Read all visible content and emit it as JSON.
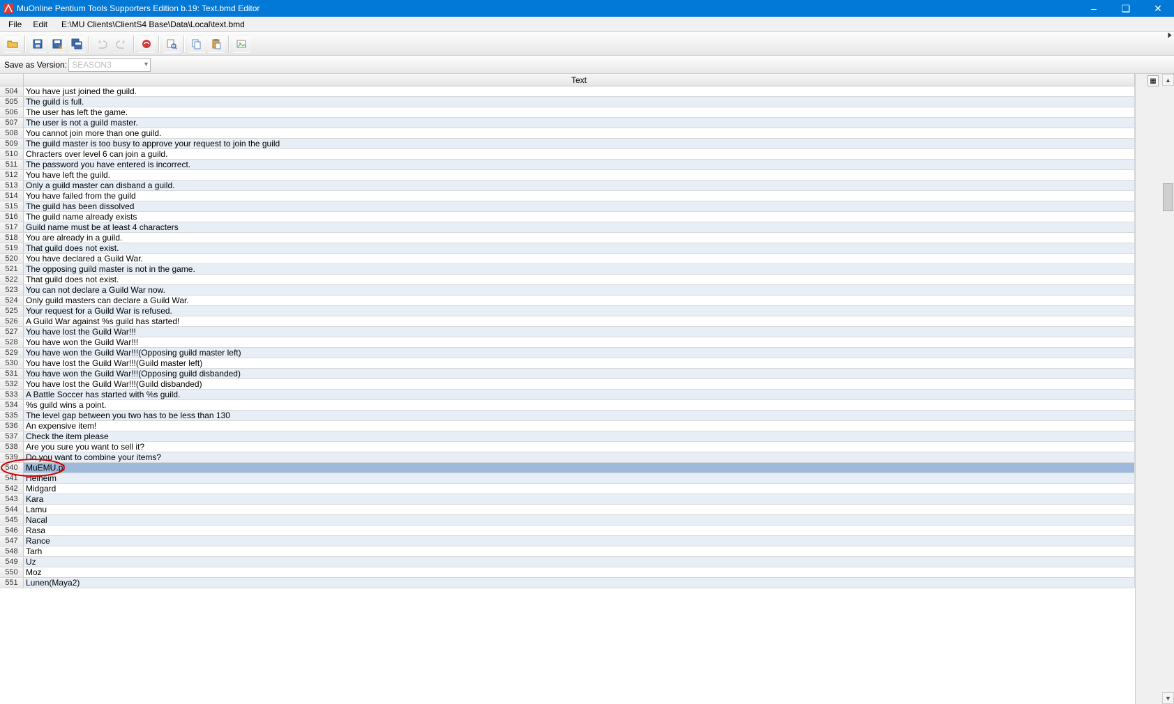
{
  "window": {
    "title": "MuOnline Pentium Tools Supporters Edition b.19: Text.bmd Editor"
  },
  "menu": {
    "file": "File",
    "edit": "Edit",
    "path": "E:\\MU Clients\\ClientS4 Base\\Data\\Local\\text.bmd"
  },
  "version": {
    "label": "Save as Version:",
    "value": "SEASON3"
  },
  "grid": {
    "column": "Text",
    "selected_id": "540",
    "rows": [
      {
        "id": "504",
        "text": "You have just joined the guild."
      },
      {
        "id": "505",
        "text": "The guild is full."
      },
      {
        "id": "506",
        "text": "The user has left the game."
      },
      {
        "id": "507",
        "text": "The user is not a guild master."
      },
      {
        "id": "508",
        "text": "You cannot join more than one guild."
      },
      {
        "id": "509",
        "text": "The guild master is too busy to approve your request to join the guild"
      },
      {
        "id": "510",
        "text": "Chracters over level 6 can join a guild."
      },
      {
        "id": "511",
        "text": "The password you have entered is incorrect."
      },
      {
        "id": "512",
        "text": "You have left the guild."
      },
      {
        "id": "513",
        "text": "Only a guild master can disband a guild."
      },
      {
        "id": "514",
        "text": "You have failed from the guild"
      },
      {
        "id": "515",
        "text": "The guild has been dissolved"
      },
      {
        "id": "516",
        "text": "The guild name already exists"
      },
      {
        "id": "517",
        "text": "Guild name must be at least 4 characters"
      },
      {
        "id": "518",
        "text": "You are already in a guild."
      },
      {
        "id": "519",
        "text": "That guild does not exist."
      },
      {
        "id": "520",
        "text": "You have declared a Guild War."
      },
      {
        "id": "521",
        "text": "The opposing guild master is not in the game."
      },
      {
        "id": "522",
        "text": "That guild does not exist."
      },
      {
        "id": "523",
        "text": "You can not declare a Guild War now."
      },
      {
        "id": "524",
        "text": "Only guild masters can declare a Guild War."
      },
      {
        "id": "525",
        "text": "Your request for a Guild War is refused."
      },
      {
        "id": "526",
        "text": "A Guild War against %s guild has started!"
      },
      {
        "id": "527",
        "text": "You have lost the Guild War!!!"
      },
      {
        "id": "528",
        "text": "You have won the Guild War!!!"
      },
      {
        "id": "529",
        "text": "You have won the Guild War!!!(Opposing guild master left)"
      },
      {
        "id": "530",
        "text": "You have lost the Guild War!!!(Guild master left)"
      },
      {
        "id": "531",
        "text": "You have won the Guild War!!!(Opposing guild disbanded)"
      },
      {
        "id": "532",
        "text": "You have lost the Guild War!!!(Guild disbanded)"
      },
      {
        "id": "533",
        "text": "A Battle Soccer has started with %s guild."
      },
      {
        "id": "534",
        "text": "%s guild wins a point."
      },
      {
        "id": "535",
        "text": "The level gap between you two has to be less than 130"
      },
      {
        "id": "536",
        "text": "An expensive item!"
      },
      {
        "id": "537",
        "text": "Check the item please"
      },
      {
        "id": "538",
        "text": "Are you sure you want to sell it?"
      },
      {
        "id": "539",
        "text": "Do you want to combine your items?"
      },
      {
        "id": "540",
        "text": "MuEMU.pl"
      },
      {
        "id": "541",
        "text": "Helheim"
      },
      {
        "id": "542",
        "text": "Midgard"
      },
      {
        "id": "543",
        "text": "Kara"
      },
      {
        "id": "544",
        "text": "Lamu"
      },
      {
        "id": "545",
        "text": "Nacal"
      },
      {
        "id": "546",
        "text": "Rasa"
      },
      {
        "id": "547",
        "text": "Rance"
      },
      {
        "id": "548",
        "text": "Tarh"
      },
      {
        "id": "549",
        "text": "Uz"
      },
      {
        "id": "550",
        "text": "Moz"
      },
      {
        "id": "551",
        "text": "Lunen(Maya2)"
      }
    ]
  }
}
